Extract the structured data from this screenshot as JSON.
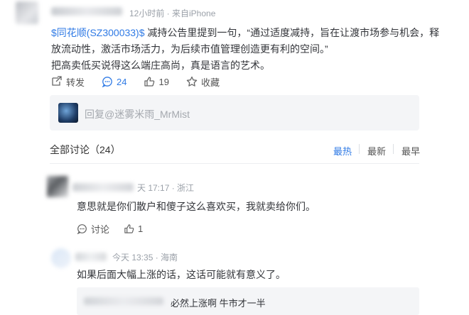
{
  "post": {
    "meta": "12小时前 · 来自iPhone",
    "stock_link": "$同花顺(SZ300033)$",
    "text_part1": " 减持公告里提到一句，“通过适度减持，旨在让渡市场参与机会，释放流动性，激活市场活力，为后续市值管理创造更有利的空间。”",
    "text_part2": "把高卖低买说得这么端庄高尚，真是语言的艺术。",
    "actions": {
      "repost_label": "转发",
      "comment_count": "24",
      "like_count": "19",
      "favorite_label": "收藏"
    }
  },
  "reply_input": {
    "placeholder": "回复@迷雾米雨_MrMist"
  },
  "discussion": {
    "title": "全部讨论（24）",
    "sort": {
      "hot": "最热",
      "new": "最新",
      "early": "最早"
    }
  },
  "comments": [
    {
      "meta": "天 17:17 · 浙江",
      "text": "意思就是你们散户和傻子这么喜欢买，我就卖给你们。",
      "discuss_label": "讨论",
      "like_count": "1"
    },
    {
      "meta": "今天 13:35 · 海南",
      "text": "如果后面大幅上涨的话，这话可能就有意义了。",
      "sub_reply": "必然上涨啊 牛市才一半"
    }
  ],
  "colors": {
    "accent": "#2f7ae5",
    "muted": "#9aa0a8",
    "panel": "#f4f5f7"
  }
}
